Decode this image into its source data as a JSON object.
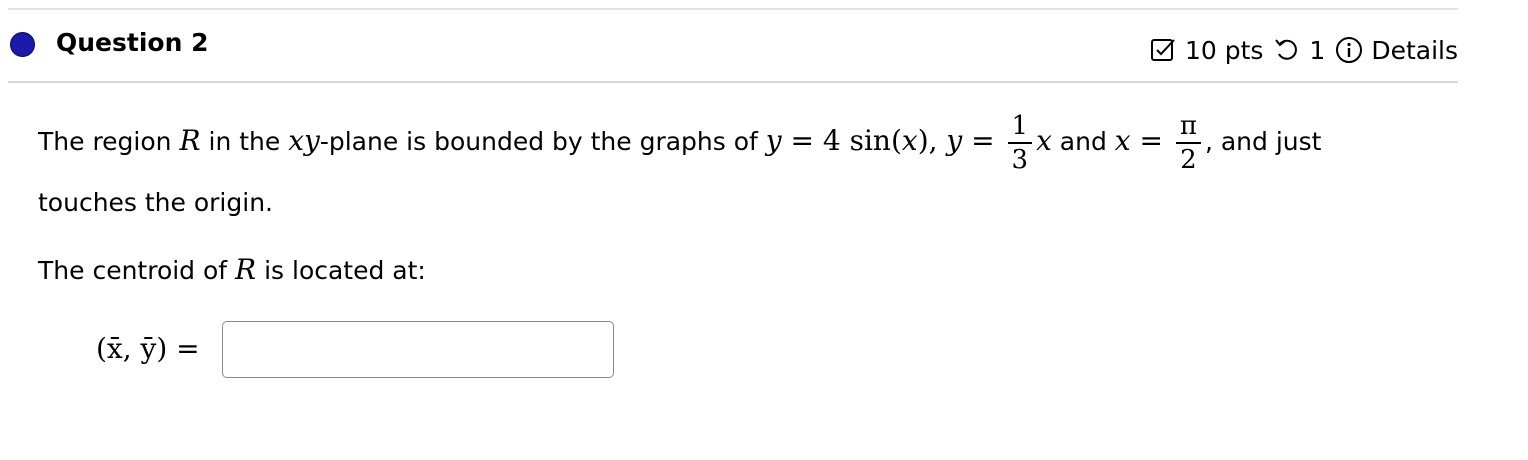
{
  "question": {
    "title": "Question 2",
    "points": "10 pts",
    "attempts": "1",
    "details_label": "Details"
  },
  "problem": {
    "part1": "The region ",
    "var_R": "R",
    "part2": " in the ",
    "xy": "xy",
    "part3": "-plane is bounded by the graphs of ",
    "eq_y1_lhs": "y",
    "eq_equals": " = ",
    "eq_y1_rhs": "4 sin(",
    "eq_x": "x",
    "eq_close": "), ",
    "eq_y2_lhs": "y",
    "frac1_num": "1",
    "frac1_den": "3",
    "eq_y2_x": "x",
    "part4": " and ",
    "eq_x2_lhs": "x",
    "frac2_num": "π",
    "frac2_den": "2",
    "part5": ", and just",
    "line2": "touches the origin.",
    "line3_a": "The centroid of ",
    "line3_R": "R",
    "line3_b": " is located at:"
  },
  "answer": {
    "label": "(x̄, ȳ) =",
    "value": ""
  },
  "icons": {
    "status": "filled-circle-icon",
    "points": "checkbox-icon",
    "attempts": "undo-icon",
    "details": "info-icon"
  },
  "colors": {
    "status_dot": "#1c1aa8"
  }
}
